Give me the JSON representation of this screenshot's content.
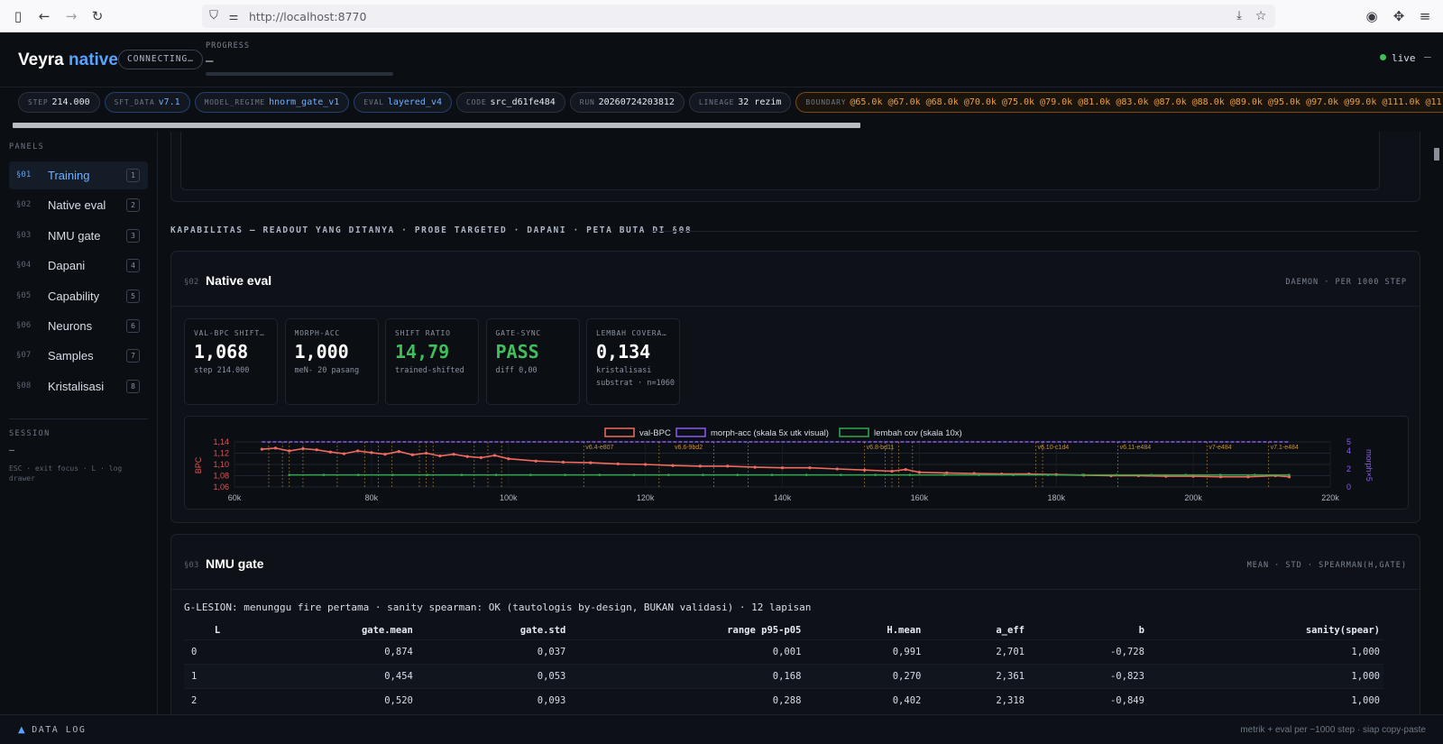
{
  "browser": {
    "url": "http://localhost:8770",
    "icons": [
      "sidebar-toggle-icon",
      "back-icon",
      "forward-icon",
      "reload-icon",
      "shield-icon",
      "permissions-icon",
      "save-page-icon",
      "bookmark-star-icon",
      "account-icon",
      "extensions-icon",
      "menu-icon"
    ]
  },
  "header": {
    "brand_main": "Veyra",
    "brand_accent": "native",
    "connection_status": "CONNECTING…",
    "progress_label": "PROGRESS",
    "progress_value": "—",
    "live_label": "live",
    "more": "–"
  },
  "chips": [
    {
      "key": "STEP",
      "value": "214.000",
      "style": "plain"
    },
    {
      "key": "SFT_DATA",
      "value": "v7.1",
      "style": "blue"
    },
    {
      "key": "MODEL_REGIME",
      "value": "hnorm_gate_v1",
      "style": "blue"
    },
    {
      "key": "EVAL",
      "value": "layered_v4",
      "style": "blue"
    },
    {
      "key": "CODE",
      "value": "src_d61fe484",
      "style": "plain"
    },
    {
      "key": "RUN",
      "value": "20260724203812",
      "style": "plain"
    },
    {
      "key": "LINEAGE",
      "value": "32 rezim",
      "style": "plain"
    },
    {
      "key": "BOUNDARY",
      "value": "@65.0k @67.0k @68.0k @70.0k @75.0k @79.0k @81.0k @83.0k @87.0k @88.0k @89.0k @95.0k @97.0k @99.0k @111.0k @11",
      "style": "orange"
    }
  ],
  "sidebar": {
    "panels_title": "PANELS",
    "items": [
      {
        "num": "§01",
        "label": "Training",
        "key": "1"
      },
      {
        "num": "§02",
        "label": "Native eval",
        "key": "2"
      },
      {
        "num": "§03",
        "label": "NMU gate",
        "key": "3"
      },
      {
        "num": "§04",
        "label": "Dapani",
        "key": "4"
      },
      {
        "num": "§05",
        "label": "Capability",
        "key": "5"
      },
      {
        "num": "§06",
        "label": "Neurons",
        "key": "6"
      },
      {
        "num": "§07",
        "label": "Samples",
        "key": "7"
      },
      {
        "num": "§08",
        "label": "Kristalisasi",
        "key": "8"
      }
    ],
    "session_title": "SESSION",
    "session_value": "—",
    "session_help": "ESC · exit focus  ·  L · log drawer"
  },
  "main": {
    "section_heading": "KAPABILITAS — READOUT YANG DITANYA · PROBE TARGETED · DAPANI · PETA BUTA DI §08",
    "native_eval": {
      "num": "§02",
      "title": "Native eval",
      "meta": "DAEMON · PER 1000 STEP",
      "stats": [
        {
          "label": "VAL-BPC SHIFT…",
          "value": "1,068",
          "sub": "step 214.000",
          "green": false
        },
        {
          "label": "MORPH-ACC",
          "value": "1,000",
          "sub": "meN- 20 pasang",
          "green": false
        },
        {
          "label": "SHIFT RATIO",
          "value": "14,79",
          "sub": "trained-shifted",
          "green": true
        },
        {
          "label": "GATE-SYNC",
          "value": "PASS",
          "sub": "diff 0,00",
          "green": true
        },
        {
          "label": "LEMBAH COVERA…",
          "value": "0,134",
          "sub": "kristalisasi substrat · n=1060",
          "green": false
        }
      ]
    },
    "nmu_gate": {
      "num": "§03",
      "title": "NMU gate",
      "meta": "MEAN · STD · SPEARMAN(H,GATE)",
      "note": "G-LESION: menunggu fire pertama · sanity spearman: OK (tautologis by-design, BUKAN validasi) · 12 lapisan",
      "columns": [
        "L",
        "gate.mean",
        "gate.std",
        "range p95-p05",
        "H.mean",
        "a_eff",
        "b",
        "sanity(spear)"
      ],
      "rows": [
        [
          "0",
          "0,874",
          "0,037",
          "0,001",
          "0,991",
          "2,701",
          "-0,728",
          "1,000"
        ],
        [
          "1",
          "0,454",
          "0,053",
          "0,168",
          "0,270",
          "2,361",
          "-0,823",
          "1,000"
        ],
        [
          "2",
          "0,520",
          "0,093",
          "0,288",
          "0,402",
          "2,318",
          "-0,849",
          "1,000"
        ]
      ]
    }
  },
  "chart_data": {
    "type": "line",
    "title": "",
    "xlabel": "",
    "ylabel": "BPC",
    "y2label": "morph×5",
    "xlim": [
      60000,
      220000
    ],
    "ylim": [
      1.06,
      1.14
    ],
    "y2lim": [
      0,
      5
    ],
    "x_ticks": [
      "60k",
      "80k",
      "100k",
      "120k",
      "140k",
      "160k",
      "180k",
      "200k",
      "220k"
    ],
    "y_ticks": [
      "1,14",
      "1,12",
      "1,10",
      "1,08",
      "1,06"
    ],
    "y2_ticks": [
      "5",
      "4",
      "2",
      "0"
    ],
    "legend_position": "top",
    "grid": true,
    "colors": {
      "val_bpc": "#f06a5e",
      "morph": "#8a5cf5",
      "lembah": "#2fa84a",
      "boundary": "#c8933a"
    },
    "series": [
      {
        "name": "val-BPC",
        "axis": "left",
        "x": [
          64000,
          66000,
          68000,
          70000,
          72000,
          74000,
          76000,
          78000,
          80000,
          82000,
          84000,
          86000,
          88000,
          90000,
          92000,
          94000,
          96000,
          98000,
          100000,
          104000,
          108000,
          112000,
          116000,
          120000,
          124000,
          128000,
          132000,
          136000,
          140000,
          144000,
          148000,
          152000,
          156000,
          158000,
          160000,
          164000,
          168000,
          172000,
          176000,
          180000,
          184000,
          188000,
          192000,
          196000,
          200000,
          204000,
          208000,
          212000,
          214000
        ],
        "values": [
          1.127,
          1.129,
          1.124,
          1.128,
          1.126,
          1.122,
          1.119,
          1.124,
          1.121,
          1.118,
          1.123,
          1.117,
          1.12,
          1.115,
          1.118,
          1.114,
          1.112,
          1.116,
          1.11,
          1.106,
          1.104,
          1.103,
          1.101,
          1.1,
          1.098,
          1.097,
          1.097,
          1.095,
          1.094,
          1.094,
          1.092,
          1.09,
          1.088,
          1.091,
          1.086,
          1.085,
          1.084,
          1.083,
          1.083,
          1.082,
          1.081,
          1.08,
          1.08,
          1.079,
          1.079,
          1.078,
          1.078,
          1.08,
          1.078
        ]
      },
      {
        "name": "morph-acc (skala 5x utk visual)",
        "axis": "right",
        "x": [
          64000,
          214000
        ],
        "values": [
          5,
          5
        ]
      },
      {
        "name": "lembah cov (skala 10x)",
        "axis": "right",
        "x": [
          68000,
          214000
        ],
        "values": [
          1.34,
          1.34
        ]
      }
    ],
    "boundaries": [
      65000,
      67000,
      68000,
      70000,
      75000,
      79000,
      81000,
      83000,
      87000,
      88000,
      89000,
      95000,
      97000,
      99000,
      111000,
      122000,
      130000,
      135000,
      152000,
      155000,
      156000,
      157000,
      159000,
      177000,
      178000,
      189000,
      202000,
      211000
    ],
    "boundary_labels": [
      {
        "x": 111000,
        "text": "v6.4-e807"
      },
      {
        "x": 124000,
        "text": "v6.6-9bd2"
      },
      {
        "x": 152000,
        "text": "v6.8-bd11"
      },
      {
        "x": 177000,
        "text": "v6.10-c1d4"
      },
      {
        "x": 189000,
        "text": "v6.11-e484"
      },
      {
        "x": 202000,
        "text": "v7-e484"
      },
      {
        "x": 211000,
        "text": "v7.1-e484"
      }
    ]
  }
}
